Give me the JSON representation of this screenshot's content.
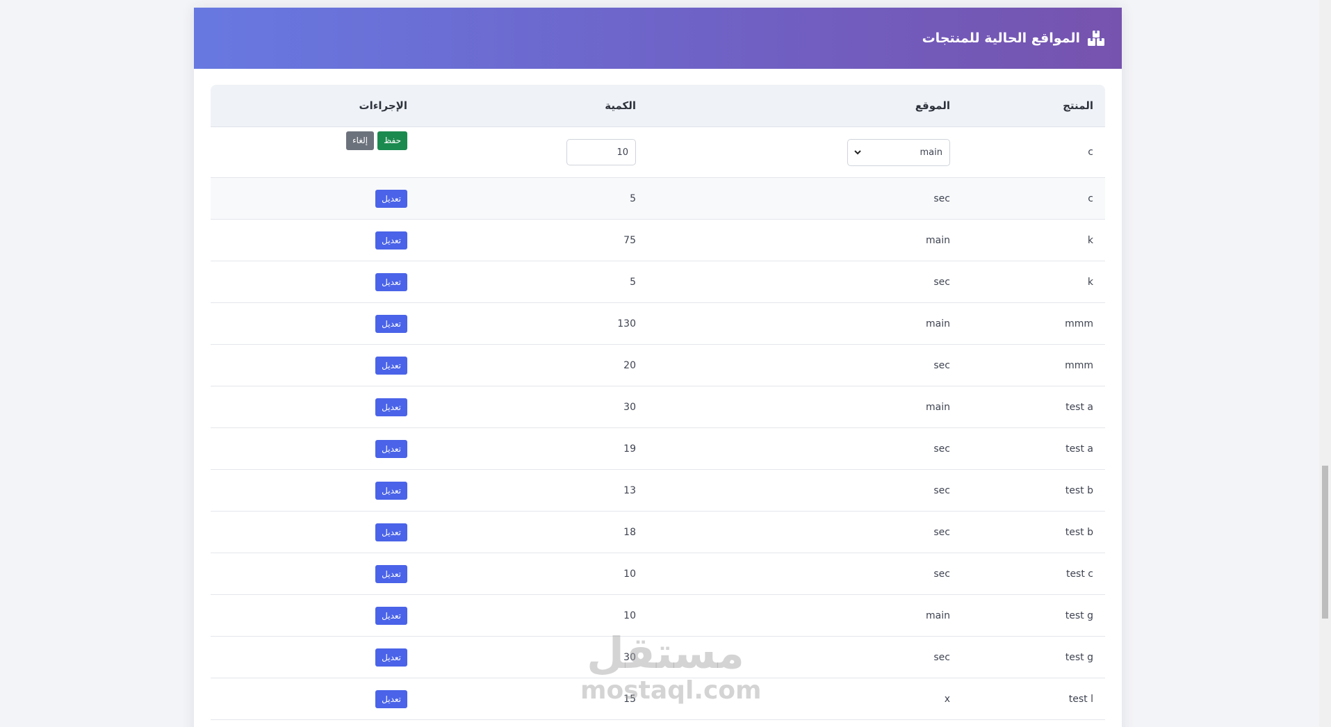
{
  "header": {
    "title": "المواقع الحالية للمنتجات",
    "icon": "boxes-icon"
  },
  "table": {
    "columns": {
      "product": "المنتج",
      "location": "الموقع",
      "quantity": "الكمية",
      "actions": "الإجراءات"
    },
    "edit_row": {
      "product": "c",
      "location_selected": "main",
      "quantity_value": "10",
      "cancel_label": "إلغاء",
      "save_label": "حفظ"
    },
    "edit_label": "تعديل",
    "rows": [
      {
        "product": "c",
        "location": "sec",
        "quantity": "5"
      },
      {
        "product": "k",
        "location": "main",
        "quantity": "75"
      },
      {
        "product": "k",
        "location": "sec",
        "quantity": "5"
      },
      {
        "product": "mmm",
        "location": "main",
        "quantity": "130"
      },
      {
        "product": "mmm",
        "location": "sec",
        "quantity": "20"
      },
      {
        "product": "test a",
        "location": "main",
        "quantity": "30"
      },
      {
        "product": "test a",
        "location": "sec",
        "quantity": "19"
      },
      {
        "product": "test b",
        "location": "sec",
        "quantity": "13"
      },
      {
        "product": "test b",
        "location": "sec",
        "quantity": "18"
      },
      {
        "product": "test c",
        "location": "sec",
        "quantity": "10"
      },
      {
        "product": "test g",
        "location": "main",
        "quantity": "10"
      },
      {
        "product": "test g",
        "location": "sec",
        "quantity": "30"
      },
      {
        "product": "test l",
        "location": "x",
        "quantity": "15"
      }
    ]
  },
  "watermark": {
    "arabic": "مستقل",
    "latin": "mostaql.com"
  },
  "colors": {
    "header_gradient_start": "#6779e1",
    "header_gradient_end": "#7653ae",
    "edit_button": "#4a63e8",
    "save_button": "#1b8a4f",
    "cancel_button": "#6c727c"
  }
}
